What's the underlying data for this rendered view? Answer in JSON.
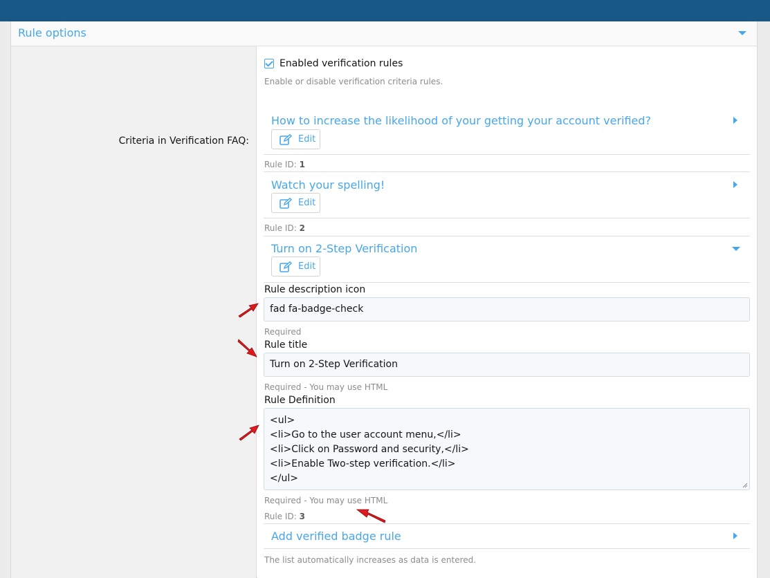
{
  "panel": {
    "title": "Rule options"
  },
  "enabled": {
    "label": "Enabled verification rules",
    "hint": "Enable or disable verification criteria rules."
  },
  "criteria": {
    "label": "Criteria in Verification FAQ:",
    "rules": [
      {
        "title": "How to increase the likelihood of your getting your account verified?",
        "edit_label": "Edit",
        "id_prefix": "Rule ID:",
        "id": "1"
      },
      {
        "title": "Watch your spelling!",
        "edit_label": "Edit",
        "id_prefix": "Rule ID:",
        "id": "2"
      },
      {
        "title": "Turn on 2-Step Verification",
        "edit_label": "Edit",
        "id_prefix": "Rule ID:",
        "id": "3"
      }
    ]
  },
  "form": {
    "icon_label": "Rule description icon",
    "icon_value": "fad fa-badge-check",
    "icon_hint": "Required",
    "title_label": "Rule title",
    "title_value": "Turn on 2-Step Verification",
    "title_hint": "Required - You may use HTML",
    "definition_label": "Rule Definition",
    "definition_lines": [
      "<ul>",
      "<li>Go to the user account menu,</li>",
      "<li>Click on Password and security,</li>",
      "<li>Enable Two-step verification.</li>",
      "</ul>"
    ],
    "definition_hint": "Required - You may use HTML"
  },
  "add_rule": {
    "label": "Add verified badge rule"
  },
  "footer_hint": "The list automatically increases as data is entered.",
  "colors": {
    "topbar": "#185886",
    "accent": "#47a7eb",
    "arrow": "#e0191f"
  }
}
